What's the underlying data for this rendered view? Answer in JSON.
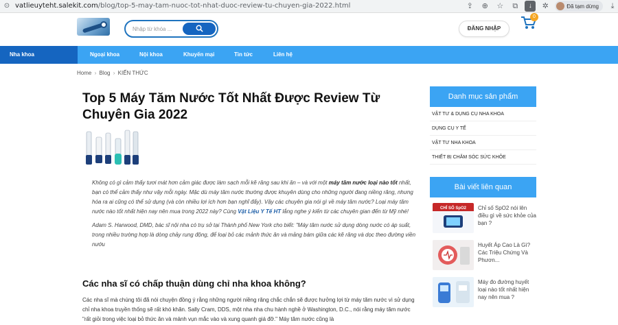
{
  "browser": {
    "url_host": "vatlieuyteht.salekit.com",
    "url_path": "/blog/top-5-may-tam-nuoc-tot-nhat-duoc-review-tu-chuyen-gia-2022.html",
    "profile_label": "Đã tạm dừng"
  },
  "header": {
    "search_placeholder": "Nhập từ khóa ...",
    "login_label": "ĐĂNG NHẬP",
    "cart_count": "0"
  },
  "nav": {
    "items": [
      {
        "label": "Nha khoa"
      },
      {
        "label": "Ngoại khoa"
      },
      {
        "label": "Nội khoa"
      },
      {
        "label": "Khuyến mại"
      },
      {
        "label": "Tin tức"
      },
      {
        "label": "Liên hệ"
      }
    ]
  },
  "breadcrumb": {
    "home": "Home",
    "blog": "Blog",
    "current": "KIẾN THỨC",
    "sep": "›"
  },
  "article": {
    "title": "Top 5 Máy Tăm Nước Tốt Nhất Được Review Từ Chuyên Gia 2022",
    "quote_p1_a": "Không có gì cảm thấy tươi mát hơn cảm giác được làm sạch mỗi kẽ răng sau khi ăn – và với một ",
    "quote_p1_b": "máy tăm nước loại nào tốt",
    "quote_p1_c": " nhất, bạn có thể cảm thấy như vậy mỗi ngày. Mặc dù máy tăm nước thường được khuyên dùng cho những người đang niềng răng, nhưng hóa ra ai cũng có thể sử dụng (và còn nhiều lợi ích hơn bạn nghĩ đấy). Vậy các chuyên gia nói gì về máy tăm nước? Loại máy tăm nước nào tốt nhất hiện nay nên mua trong 2022 này? Cùng ",
    "quote_p1_link": "Vật Liệu Y Tế HT",
    "quote_p1_d": " lắng nghe ý kiến từ các chuyên gian đến từ Mỹ nhé!",
    "quote_p2": "Adam S. Harwood, DMD, bác sĩ nội nha có trụ sở tại Thành phố New York cho biết: \"Máy tăm nước sử dụng dòng nước có áp suất, trong nhiều trường hợp là dòng chảy rung động, để loại bỏ các mảnh thức ăn và mảng bám giữa các kẽ răng và dọc theo đường viền nướu",
    "h2": "Các nha sĩ có chấp thuận dùng chỉ nha khoa không?",
    "body": "Các nha sĩ mà chúng tôi đã nói chuyện đồng ý rằng những người niềng răng chắc chắn sẽ được hưởng lợi từ máy tăm nước vì sử dụng chỉ nha khoa truyền thống sẽ rất khó khăn. Sally Cram, DDS, một nha nha chu hành nghề ở Washington, D.C., nói rằng máy tăm nước \"rất giỏi trong việc loại bỏ thức ăn và mảnh vụn mắc vào và xung quanh giá đỡ.\" Máy tăm nước cũng là"
  },
  "sidebar": {
    "categories_title": "Danh mục sản phẩm",
    "categories": [
      "VẬT TƯ & DỤNG CỤ NHA KHOA",
      "DỤNG CỤ Y TẾ",
      "VẬT TƯ NHA KHOA",
      "THIẾT BỊ CHĂM SÓC SỨC KHỎE"
    ],
    "posts_title": "Bài viết liên quan",
    "posts": [
      {
        "title": "Chỉ số SpO2 nói lên điều gì về sức khỏe của bạn ?",
        "thumb_caption": "CHỈ SỐ SpO2"
      },
      {
        "title": "Huyết Áp Cao Là Gì? Các Triệu Chứng Và Phươn..."
      },
      {
        "title": "Máy đo đường huyết loại nào tốt nhất hiện nay nên mua ?"
      }
    ]
  },
  "colors": {
    "nav": "#3ba4f3",
    "nav_active": "#1565c0",
    "link": "#1e5fa8"
  }
}
